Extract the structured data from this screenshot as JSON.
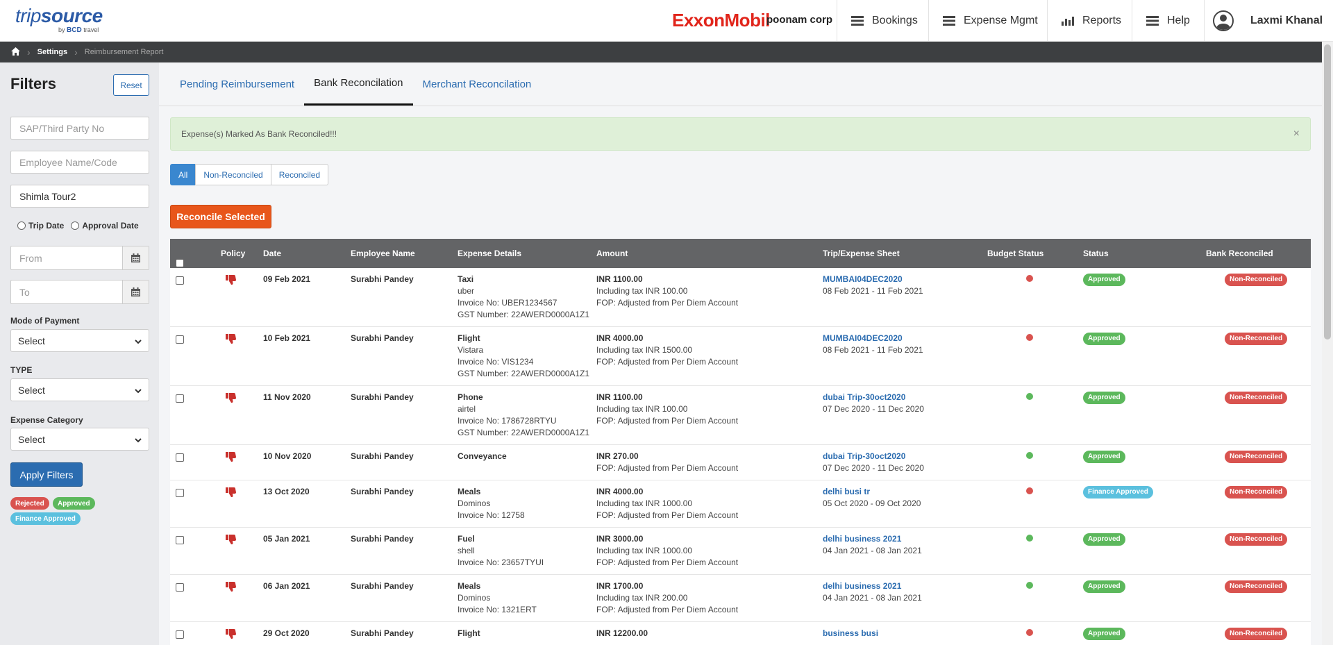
{
  "header": {
    "logo_main_a": "trip",
    "logo_main_b": "source",
    "logo_by": "by",
    "logo_bcd": "BCD",
    "logo_travel": "travel",
    "brand": "ExxonMobil",
    "company": "poonam corp",
    "nav": [
      {
        "label": "Bookings",
        "icon": "menu-icon"
      },
      {
        "label": "Expense Mgmt",
        "icon": "menu-icon"
      },
      {
        "label": "Reports",
        "icon": "bar-chart-icon"
      },
      {
        "label": "Help",
        "icon": "menu-icon"
      }
    ],
    "user_name": "Laxmi Khanal"
  },
  "breadcrumb": {
    "items": [
      "Settings",
      "Reimbursement Report"
    ]
  },
  "sidebar": {
    "title": "Filters",
    "reset_label": "Reset",
    "sap_placeholder": "SAP/Third Party No",
    "employee_placeholder": "Employee Name/Code",
    "trip_value": "Shimla Tour2",
    "radio_trip": "Trip Date",
    "radio_approval": "Approval Date",
    "from_placeholder": "From",
    "to_placeholder": "To",
    "mode_label": "Mode of Payment",
    "mode_value": "Select",
    "type_label": "TYPE",
    "type_value": "Select",
    "category_label": "Expense Category",
    "category_value": "Select",
    "apply_label": "Apply Filters",
    "legend": [
      {
        "label": "Rejected",
        "color": "#d9534f"
      },
      {
        "label": "Approved",
        "color": "#5cb85c"
      },
      {
        "label": "Finance Approved",
        "color": "#5bc0de"
      }
    ]
  },
  "tabs": [
    "Pending Reimbursement",
    "Bank Reconcilation",
    "Merchant Reconcilation"
  ],
  "active_tab": 1,
  "alert": {
    "message": "Expense(s) Marked As Bank Reconciled!!!",
    "close": "×"
  },
  "segments": [
    "All",
    "Non-Reconciled",
    "Reconciled"
  ],
  "reconcile_label": "Reconcile Selected",
  "table": {
    "headers": [
      "Policy",
      "Date",
      "Employee Name",
      "Expense Details",
      "Amount",
      "Trip/Expense Sheet",
      "Budget Status",
      "Status",
      "Bank Reconciled"
    ],
    "rows": [
      {
        "date": "09 Feb 2021",
        "employee": "Surabhi Pandey",
        "details": [
          "Taxi",
          "uber",
          "Invoice No: UBER1234567",
          "GST Number: 22AWERD0000A1Z1"
        ],
        "amount": [
          "INR 1100.00",
          "Including tax INR 100.00",
          "FOP: Adjusted from Per Diem Account"
        ],
        "trip": "MUMBAI04DEC2020",
        "trip_dates": "08 Feb 2021 - 11 Feb 2021",
        "budget_color": "#d9534f",
        "status": "Approved",
        "status_color": "#5cb85c",
        "bank": "Non-Reconciled"
      },
      {
        "date": "10 Feb 2021",
        "employee": "Surabhi Pandey",
        "details": [
          "Flight",
          "Vistara",
          "Invoice No: VIS1234",
          "GST Number: 22AWERD0000A1Z1"
        ],
        "amount": [
          "INR 4000.00",
          "Including tax INR 1500.00",
          "FOP: Adjusted from Per Diem Account"
        ],
        "trip": "MUMBAI04DEC2020",
        "trip_dates": "08 Feb 2021 - 11 Feb 2021",
        "budget_color": "#d9534f",
        "status": "Approved",
        "status_color": "#5cb85c",
        "bank": "Non-Reconciled"
      },
      {
        "date": "11 Nov 2020",
        "employee": "Surabhi Pandey",
        "details": [
          "Phone",
          "airtel",
          "Invoice No: 1786728RTYU",
          "GST Number: 22AWERD0000A1Z1"
        ],
        "amount": [
          "INR 1100.00",
          "Including tax INR 100.00",
          "FOP: Adjusted from Per Diem Account"
        ],
        "trip": "dubai Trip-30oct2020",
        "trip_dates": "07 Dec 2020 - 11 Dec 2020",
        "budget_color": "#5cb85c",
        "status": "Approved",
        "status_color": "#5cb85c",
        "bank": "Non-Reconciled"
      },
      {
        "date": "10 Nov 2020",
        "employee": "Surabhi Pandey",
        "details": [
          "Conveyance"
        ],
        "amount": [
          "INR 270.00",
          "FOP: Adjusted from Per Diem Account"
        ],
        "trip": "dubai Trip-30oct2020",
        "trip_dates": "07 Dec 2020 - 11 Dec 2020",
        "budget_color": "#5cb85c",
        "status": "Approved",
        "status_color": "#5cb85c",
        "bank": "Non-Reconciled"
      },
      {
        "date": "13 Oct 2020",
        "employee": "Surabhi Pandey",
        "details": [
          "Meals",
          "Dominos",
          "Invoice No: 12758"
        ],
        "amount": [
          "INR 4000.00",
          "Including tax INR 1000.00",
          "FOP: Adjusted from Per Diem Account"
        ],
        "trip": "delhi busi tr",
        "trip_dates": "05 Oct 2020 - 09 Oct 2020",
        "budget_color": "#d9534f",
        "status": "Finance Approved",
        "status_color": "#5bc0de",
        "bank": "Non-Reconciled"
      },
      {
        "date": "05 Jan 2021",
        "employee": "Surabhi Pandey",
        "details": [
          "Fuel",
          "shell",
          "Invoice No: 23657TYUI"
        ],
        "amount": [
          "INR 3000.00",
          "Including tax INR 1000.00",
          "FOP: Adjusted from Per Diem Account"
        ],
        "trip": "delhi business 2021",
        "trip_dates": "04 Jan 2021 - 08 Jan 2021",
        "budget_color": "#5cb85c",
        "status": "Approved",
        "status_color": "#5cb85c",
        "bank": "Non-Reconciled"
      },
      {
        "date": "06 Jan 2021",
        "employee": "Surabhi Pandey",
        "details": [
          "Meals",
          "Dominos",
          "Invoice No: 1321ERT"
        ],
        "amount": [
          "INR 1700.00",
          "Including tax INR 200.00",
          "FOP: Adjusted from Per Diem Account"
        ],
        "trip": "delhi business 2021",
        "trip_dates": "04 Jan 2021 - 08 Jan 2021",
        "budget_color": "#5cb85c",
        "status": "Approved",
        "status_color": "#5cb85c",
        "bank": "Non-Reconciled"
      },
      {
        "date": "29 Oct 2020",
        "employee": "Surabhi Pandey",
        "details": [
          "Flight"
        ],
        "amount": [
          "INR 12200.00"
        ],
        "trip": "business busi",
        "trip_dates": "",
        "budget_color": "#d9534f",
        "status": "Approved",
        "status_color": "#5cb85c",
        "bank": "Non-Reconciled"
      }
    ]
  }
}
